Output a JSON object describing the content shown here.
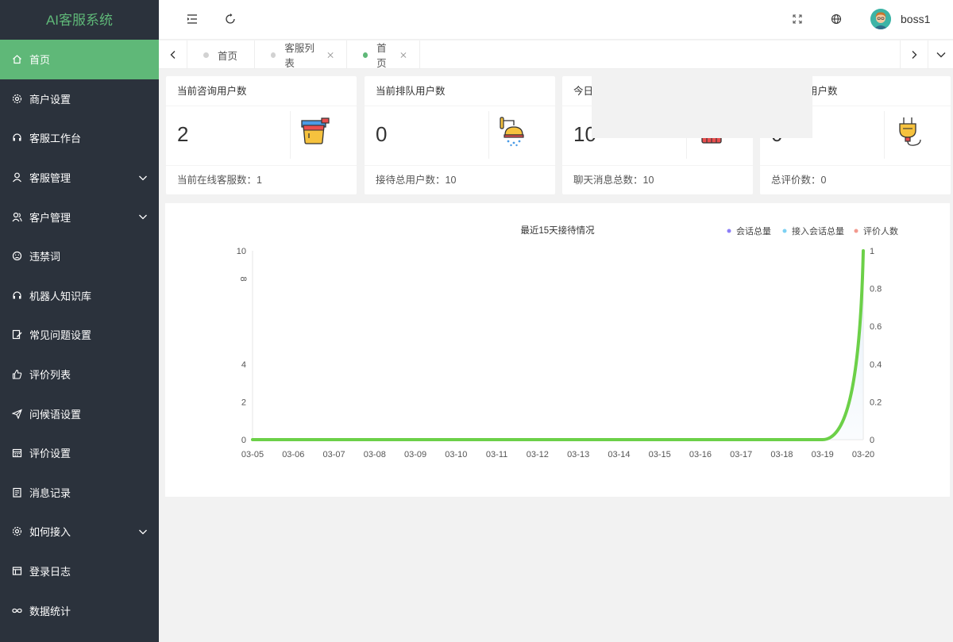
{
  "app": {
    "title": "AI客服系统"
  },
  "sidebar": {
    "items": [
      {
        "label": "首页",
        "icon": "home-icon",
        "active": true,
        "expandable": false
      },
      {
        "label": "商户设置",
        "icon": "gear-icon",
        "active": false,
        "expandable": false
      },
      {
        "label": "客服工作台",
        "icon": "headset-icon",
        "active": false,
        "expandable": false
      },
      {
        "label": "客服管理",
        "icon": "user-icon",
        "active": false,
        "expandable": true
      },
      {
        "label": "客户管理",
        "icon": "users-icon",
        "active": false,
        "expandable": true
      },
      {
        "label": "违禁词",
        "icon": "face-icon",
        "active": false,
        "expandable": false
      },
      {
        "label": "机器人知识库",
        "icon": "robot-headset-icon",
        "active": false,
        "expandable": false
      },
      {
        "label": "常见问题设置",
        "icon": "edit-icon",
        "active": false,
        "expandable": false
      },
      {
        "label": "评价列表",
        "icon": "thumbs-up-icon",
        "active": false,
        "expandable": false
      },
      {
        "label": "问候语设置",
        "icon": "send-icon",
        "active": false,
        "expandable": false
      },
      {
        "label": "评价设置",
        "icon": "calendar-icon",
        "active": false,
        "expandable": false
      },
      {
        "label": "消息记录",
        "icon": "document-icon",
        "active": false,
        "expandable": false
      },
      {
        "label": "如何接入",
        "icon": "cog-icon",
        "active": false,
        "expandable": true
      },
      {
        "label": "登录日志",
        "icon": "window-icon",
        "active": false,
        "expandable": false
      },
      {
        "label": "数据统计",
        "icon": "infinity-icon",
        "active": false,
        "expandable": false
      }
    ]
  },
  "header": {
    "username": "boss1"
  },
  "tabs": [
    {
      "label": "首页",
      "active": false,
      "closable": false
    },
    {
      "label": "客服列表",
      "active": false,
      "closable": true
    },
    {
      "label": "首页",
      "active": true,
      "closable": true
    }
  ],
  "cards": [
    {
      "title": "当前咨询用户数",
      "value": "2",
      "footer": "当前在线客服数：1",
      "icon": "paint-bucket-icon"
    },
    {
      "title": "当前排队用户数",
      "value": "0",
      "footer": "接待总用户数：10",
      "icon": "shower-icon"
    },
    {
      "title": "今日",
      "value": "10",
      "footer": "聊天消息总数：10",
      "icon": "radiator-icon"
    },
    {
      "title": "用户数",
      "value": "0",
      "footer": "总评价数：0",
      "icon": "plug-icon"
    }
  ],
  "colors": {
    "accent": "#5fb878",
    "sidebar_bg": "#2b323c",
    "series1": "#8c7ef7",
    "series2": "#7dd1f2",
    "series3": "#f29a8f",
    "line_green": "#6cd048"
  },
  "chart_data": {
    "type": "line",
    "title": "最近15天接待情况",
    "categories": [
      "03-05",
      "03-06",
      "03-07",
      "03-08",
      "03-09",
      "03-10",
      "03-11",
      "03-12",
      "03-13",
      "03-14",
      "03-15",
      "03-16",
      "03-17",
      "03-18",
      "03-19",
      "03-20"
    ],
    "left_axis": {
      "ticks": [
        "10",
        "8",
        "4",
        "2",
        "0"
      ],
      "ylim": [
        0,
        10
      ]
    },
    "right_axis": {
      "ticks": [
        "1",
        "0.8",
        "0.6",
        "0.4",
        "0.2",
        "0"
      ],
      "ylim": [
        0,
        1
      ]
    },
    "legend_position": "top-right",
    "series": [
      {
        "name": "会话总量",
        "axis": "left",
        "values": [
          0,
          0,
          0,
          0,
          0,
          0,
          0,
          0,
          0,
          0,
          0,
          0,
          0,
          0,
          0,
          10
        ]
      },
      {
        "name": "接入会话总量",
        "axis": "left",
        "values": [
          0,
          0,
          0,
          0,
          0,
          0,
          0,
          0,
          0,
          0,
          0,
          0,
          0,
          0,
          0,
          0
        ]
      },
      {
        "name": "评价人数",
        "axis": "right",
        "values": [
          0,
          0,
          0,
          0,
          0,
          0,
          0,
          0,
          0,
          0,
          0,
          0,
          0,
          0,
          0,
          0
        ]
      }
    ]
  }
}
